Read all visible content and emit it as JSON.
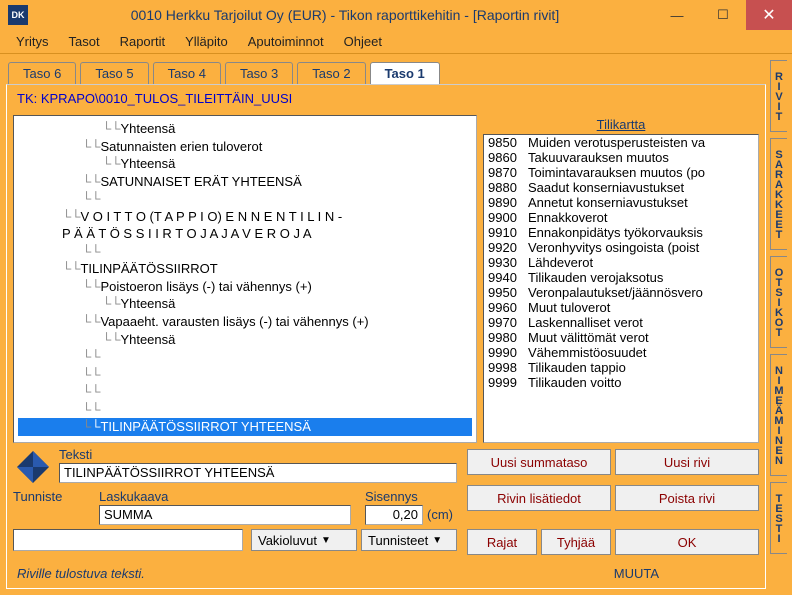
{
  "window": {
    "title": "0010  Herkku Tarjoilut Oy (EUR) - Tikon raporttikehitin - [Raportin rivit]",
    "icon_text": "DK"
  },
  "menu": [
    "Yritys",
    "Tasot",
    "Raportit",
    "Ylläpito",
    "Aputoiminnot",
    "Ohjeet"
  ],
  "tabs": [
    "Taso 6",
    "Taso 5",
    "Taso 4",
    "Taso 3",
    "Taso 2",
    "Taso 1"
  ],
  "active_tab": "Taso 1",
  "path": "TK: KPRAPO\\0010_TULOS_TILEITTÄIN_UUSI",
  "tree": [
    {
      "lvl": 3,
      "txt": "Yhteensä",
      "br": 1
    },
    {
      "lvl": 2,
      "txt": "Satunnaisten erien tuloverot",
      "br": 1
    },
    {
      "lvl": 3,
      "txt": "Yhteensä",
      "br": 1
    },
    {
      "lvl": 2,
      "txt": "SATUNNAISET ERÄT YHTEENSÄ",
      "br": 1
    },
    {
      "lvl": 2,
      "txt": "",
      "br": 1
    },
    {
      "lvl": 1,
      "txt": "V O I T T O  (T A P P I O)  E N N E N  T I L I N -",
      "br": 1
    },
    {
      "lvl": 1,
      "txt": "P Ä Ä T Ö S S I I R T O J A  J A  V E R O J A",
      "br": 0
    },
    {
      "lvl": 2,
      "txt": "",
      "br": 1
    },
    {
      "lvl": 1,
      "txt": "TILINPÄÄTÖSSIIRROT",
      "br": 1
    },
    {
      "lvl": 2,
      "txt": "Poistoeron lisäys (-) tai vähennys (+)",
      "br": 1
    },
    {
      "lvl": 3,
      "txt": "Yhteensä",
      "br": 1
    },
    {
      "lvl": 2,
      "txt": "Vapaaeht. varausten lisäys (-) tai vähennys (+)",
      "br": 1
    },
    {
      "lvl": 3,
      "txt": "Yhteensä",
      "br": 1
    },
    {
      "lvl": 2,
      "txt": "",
      "br": 1
    },
    {
      "lvl": 2,
      "txt": "",
      "br": 1
    },
    {
      "lvl": 2,
      "txt": "",
      "br": 1
    },
    {
      "lvl": 2,
      "txt": "",
      "br": 1
    },
    {
      "lvl": 2,
      "txt": "TILINPÄÄTÖSSIIRROT YHTEENSÄ",
      "br": 1,
      "sel": 1
    }
  ],
  "chart": {
    "header": "Tilikartta",
    "rows": [
      {
        "c": "9850",
        "t": "Muiden verotusperusteisten va"
      },
      {
        "c": "9860",
        "t": "Takuuvarauksen muutos"
      },
      {
        "c": "9870",
        "t": "Toimintavarauksen muutos (po"
      },
      {
        "c": "9880",
        "t": "Saadut konserniavustukset"
      },
      {
        "c": "9890",
        "t": "Annetut konserniavustukset"
      },
      {
        "c": "9900",
        "t": "Ennakkoverot"
      },
      {
        "c": "9910",
        "t": "Ennakonpidätys työkorvauksis"
      },
      {
        "c": "9920",
        "t": "Veronhyvitys osingoista (poist"
      },
      {
        "c": "9930",
        "t": "Lähdeverot"
      },
      {
        "c": "9940",
        "t": "Tilikauden verojaksotus"
      },
      {
        "c": "9950",
        "t": "Veronpalautukset/jäännösvero"
      },
      {
        "c": "9960",
        "t": "Muut tuloverot"
      },
      {
        "c": "9970",
        "t": "Laskennalliset verot"
      },
      {
        "c": "9980",
        "t": "Muut välittömät verot"
      },
      {
        "c": "9990",
        "t": "Vähemmistöosuudet"
      },
      {
        "c": "9998",
        "t": "Tilikauden tappio"
      },
      {
        "c": "9999",
        "t": "Tilikauden voitto"
      }
    ]
  },
  "form": {
    "teksti_label": "Teksti",
    "teksti_value": "TILINPÄÄTÖSSIIRROT YHTEENSÄ",
    "tunniste_label": "Tunniste",
    "laskukaava_label": "Laskukaava",
    "laskukaava_value": "SUMMA",
    "sisennys_label": "Sisennys",
    "sisennys_value": "0,20",
    "cm": "(cm)",
    "vakioluvut": "Vakioluvut",
    "tunnisteet": "Tunnisteet"
  },
  "buttons": {
    "uusi_summataso": "Uusi summataso",
    "uusi_rivi": "Uusi rivi",
    "rivin_lisatiedot": "Rivin lisätiedot",
    "poista_rivi": "Poista rivi",
    "rajat": "Rajat",
    "tyhjaa": "Tyhjää",
    "ok": "OK"
  },
  "status": {
    "left": "Riville tulostuva teksti.",
    "right": "MUUTA"
  },
  "sidetabs": [
    "RIVIT",
    "SARAKKEET",
    "OTSIKOT",
    "NIMEÄMINEN",
    "TESTI"
  ]
}
